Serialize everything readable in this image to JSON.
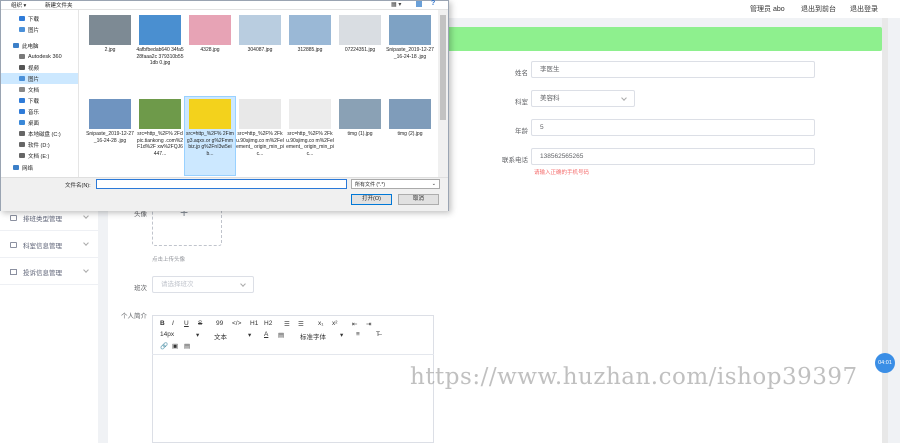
{
  "header": {
    "admin_label": "管理员 abo",
    "back_home": "退出到前台",
    "logout": "退出登录"
  },
  "sidebar": {
    "items": [
      {
        "label": "排班类型管理"
      },
      {
        "label": "科室信息管理"
      },
      {
        "label": "投诉信息管理"
      }
    ]
  },
  "form": {
    "name": {
      "label": "姓名",
      "value": "李医生"
    },
    "department": {
      "label": "科室",
      "value": "美容科"
    },
    "age": {
      "label": "年龄",
      "value": "5"
    },
    "phone": {
      "label": "联系电话",
      "value": "138562565265"
    },
    "phone_error": "请输入正确的手机号码",
    "avatar": {
      "label": "头像",
      "hint": "点击上传头像"
    },
    "shift": {
      "label": "班次",
      "placeholder": "请选择班次"
    },
    "intro": {
      "label": "个人简介"
    }
  },
  "editor": {
    "row1": [
      "B",
      "I",
      "U",
      "S",
      "99",
      "</>",
      "H1",
      "H2",
      "☰",
      "☰",
      "x₁",
      "x²",
      "⇤",
      "⇥"
    ],
    "font_size": "14px",
    "text_type": "文本",
    "font_family": "标准字体",
    "row3": [
      "🔗",
      "▣",
      "▤"
    ]
  },
  "float_button": "04:01",
  "watermark": "https://www.huzhan.com/ishop39397",
  "dialog": {
    "toolbar": {
      "organize": "组织 ▾",
      "new_folder": "新建文件夹"
    },
    "nav": [
      {
        "label": "下载",
        "icon": "download-icon",
        "color": "#2f7bd8"
      },
      {
        "label": "图片",
        "icon": "pictures-icon",
        "color": "#4a90d9"
      },
      {
        "label": "此电脑",
        "icon": "computer-icon",
        "color": "#3c7fc8"
      },
      {
        "label": "Autodesk 360",
        "icon": "cloud-icon",
        "color": "#7a7a7a"
      },
      {
        "label": "视频",
        "icon": "video-icon",
        "color": "#555"
      },
      {
        "label": "图片",
        "icon": "pictures-icon",
        "color": "#4a90d9",
        "selected": true
      },
      {
        "label": "文档",
        "icon": "documents-icon",
        "color": "#888"
      },
      {
        "label": "下载",
        "icon": "download-icon",
        "color": "#2f7bd8"
      },
      {
        "label": "音乐",
        "icon": "music-icon",
        "color": "#2f7bd8"
      },
      {
        "label": "桌面",
        "icon": "desktop-icon",
        "color": "#3a88d8"
      },
      {
        "label": "本地磁盘 (C:)",
        "icon": "drive-icon",
        "color": "#666"
      },
      {
        "label": "软件 (D:)",
        "icon": "drive-icon",
        "color": "#666"
      },
      {
        "label": "文档 (E:)",
        "icon": "drive-icon",
        "color": "#666"
      },
      {
        "label": "网络",
        "icon": "network-icon",
        "color": "#3c7fc8"
      }
    ],
    "files": [
      {
        "name": "2.jpg",
        "color": "#7d8a94"
      },
      {
        "name": "4afbfbedab640 34fa528faaa2c 379310b551db 0.jpg",
        "color": "#4a8fd0"
      },
      {
        "name": "4328.jpg",
        "color": "#e7a3b5"
      },
      {
        "name": "304087.jpg",
        "color": "#b9cde0"
      },
      {
        "name": "312885.jpg",
        "color": "#9ab8d6"
      },
      {
        "name": "07224351.jpg",
        "color": "#d9dde2"
      },
      {
        "name": "Snipaste_2019-12-27_16-24-18 .jpg",
        "color": "#7ea2c4"
      },
      {
        "name": "Snipaste_2019-12-27_16-24-28 .jpg",
        "color": "#6f94c0"
      },
      {
        "name": "src=http_%2F% 2Fdpic.tiankong .com%2F1d%2F xw%2FQJ6447...",
        "color": "#6e9a4a"
      },
      {
        "name": "src=http_%2F% 2Fimg3.aqxx.or g%2Fmmbiz.jp g%2FnI3w5eib...",
        "color": "#f3d21c",
        "selected": true
      },
      {
        "name": "src=http_%2F% 2Fku.90sjimg.co m%2Felement_ origin_min_pic...",
        "color": "#e8e8e8"
      },
      {
        "name": "src=http_%2F% 2Fku.90sjimg.co m%2Felement_ origin_min_pic...",
        "color": "#ececec"
      },
      {
        "name": "timg (1).jpg",
        "color": "#8aa1b5"
      },
      {
        "name": "timg (2).jpg",
        "color": "#7f9cba"
      }
    ],
    "filename_label": "文件名(N):",
    "filename_value": "",
    "filetype": "所有文件 (*.*)",
    "open_button": "打开(O)",
    "cancel_button": "取消"
  }
}
